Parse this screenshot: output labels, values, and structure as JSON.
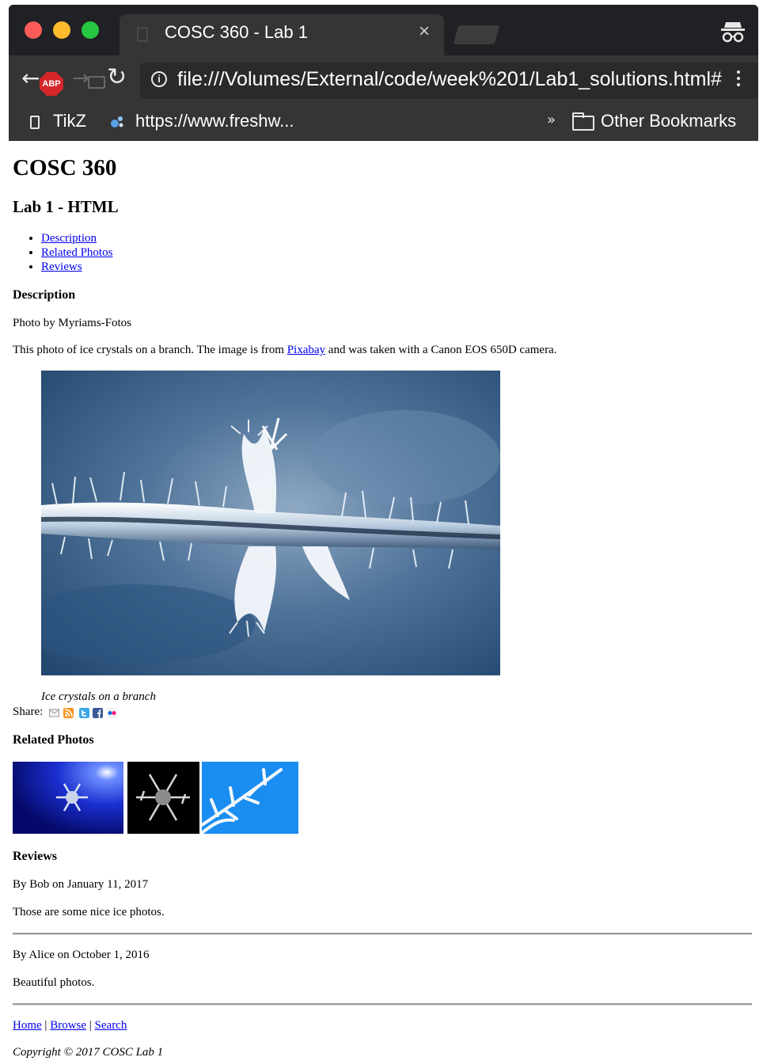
{
  "browser": {
    "tab_title": "COSC 360 - Lab 1",
    "tab_close": "×",
    "url": "file:///Volumes/External/code/week%201/Lab1_solutions.html#",
    "abp_label": "ABP",
    "bookmarks": [
      {
        "label": "TikZ",
        "icon": "page-icon"
      },
      {
        "label": "https://www.freshw...",
        "icon": "freshworks-icon"
      }
    ],
    "overflow_label": "»",
    "other_bookmarks": "Other Bookmarks"
  },
  "page": {
    "title": "COSC 360",
    "subtitle": "Lab 1 - HTML",
    "nav": [
      "Description",
      "Related Photos",
      "Reviews"
    ],
    "description": {
      "heading": "Description",
      "credit": "Photo by Myriams-Fotos",
      "text_before": "This photo of ice crystals on a branch. The image is from ",
      "link": "Pixabay",
      "text_after": " and was taken with a Canon EOS 650D camera.",
      "caption": "Ice crystals on a branch"
    },
    "share": {
      "label": "Share:",
      "icons": [
        "email-icon",
        "rss-icon",
        "twitter-icon",
        "facebook-icon",
        "flickr-icon"
      ],
      "colors": {
        "rss": "#f7931e",
        "twitter": "#3aa8e6",
        "facebook": "#3b5998",
        "flickr_pink": "#ff0084",
        "flickr_blue": "#0063dc"
      }
    },
    "related": {
      "heading": "Related Photos"
    },
    "reviews": {
      "heading": "Reviews",
      "items": [
        {
          "byline": "By Bob on January 11, 2017",
          "text": "Those are some nice ice photos."
        },
        {
          "byline": "By Alice on October 1, 2016",
          "text": "Beautiful photos."
        }
      ]
    },
    "footer": {
      "links": [
        "Home",
        "Browse",
        "Search"
      ],
      "separator": "|",
      "copyright": "Copyright © 2017 COSC Lab 1"
    }
  }
}
